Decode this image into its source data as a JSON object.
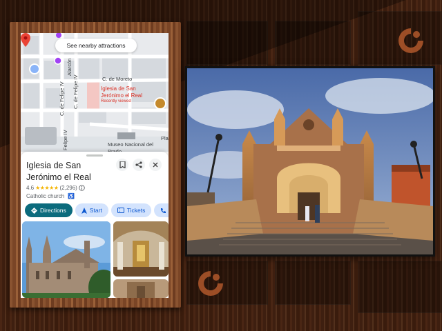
{
  "map": {
    "nearby_chip": "See nearby attractions",
    "streets": {
      "moreto": "C. de Moreto",
      "felipe_iv_a": "C. de Felipe IV",
      "felipe_iv_b": "C. de Felipe IV",
      "felipe_iv_c": "Felipe IV",
      "alarcon": "Alarcón",
      "pla": "Pla"
    },
    "place_label": "Iglesia de San Jerónimo el Real",
    "place_sub": "Recently viewed",
    "museum_label": "Museo Nacional del Prado"
  },
  "place": {
    "title": "Iglesia de San Jerónimo el Real",
    "rating": "4.6",
    "stars": "★★★★★",
    "reviews": "(2,296)",
    "category": "Catholic church",
    "accessible_icon": "wheelchair-icon"
  },
  "actions": [
    {
      "label": "Directions",
      "icon": "directions-icon",
      "primary": true
    },
    {
      "label": "Start",
      "icon": "navigation-arrow-icon",
      "primary": false
    },
    {
      "label": "Tickets",
      "icon": "ticket-icon",
      "primary": false
    },
    {
      "label": "C",
      "icon": "phone-icon",
      "primary": false
    }
  ],
  "colors": {
    "accent_primary": "#0b6b7d",
    "pin_red": "#d93025",
    "pill_bg": "#d3e3fd",
    "background_wood": "#3a1d0e"
  }
}
